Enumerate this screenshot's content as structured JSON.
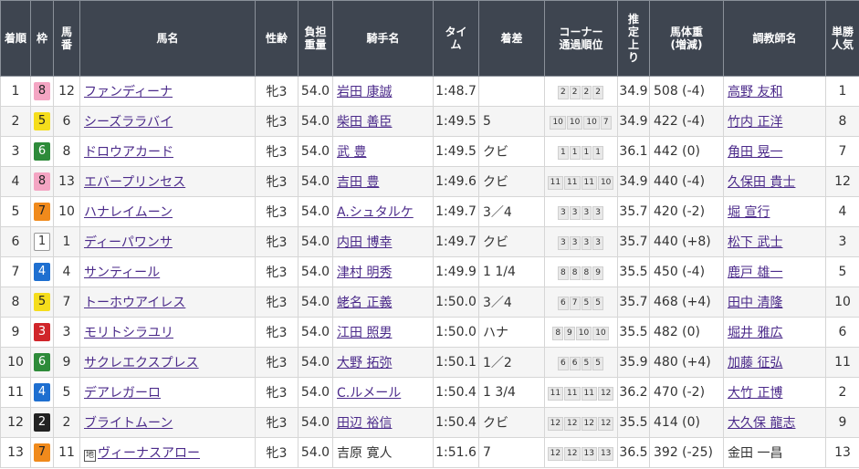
{
  "headers": {
    "rank": "着順",
    "waku": "枠",
    "umaban_1": "馬",
    "umaban_2": "番",
    "horse": "馬名",
    "sexage": "性齢",
    "weight_1": "負担",
    "weight_2": "重量",
    "jockey": "騎手名",
    "time_1": "タイ",
    "time_2": "ム",
    "margin": "着差",
    "corner_1": "コーナー",
    "corner_2": "通過順位",
    "last3f_1": "推",
    "last3f_2": "定",
    "last3f_3": "上",
    "last3f_4": "り",
    "bodyweight_1": "馬体重",
    "bodyweight_2": "(増減)",
    "trainer": "調教師名",
    "pop_1": "単勝",
    "pop_2": "人気"
  },
  "rows": [
    {
      "rank": "1",
      "waku": "8",
      "umaban": "12",
      "horse": "ファンディーナ",
      "sexage": "牝3",
      "weight": "54.0",
      "jockey": "岩田 康誠",
      "time": "1:48.7",
      "margin": "",
      "corners": [
        "2",
        "2",
        "2",
        "2"
      ],
      "last3f": "34.9",
      "bodyweight": "508 (-4)",
      "trainer": "高野 友和",
      "pop": "1"
    },
    {
      "rank": "2",
      "waku": "5",
      "umaban": "6",
      "horse": "シーズララバイ",
      "sexage": "牝3",
      "weight": "54.0",
      "jockey": "柴田 善臣",
      "time": "1:49.5",
      "margin": "5",
      "corners": [
        "10",
        "10",
        "10",
        "7"
      ],
      "last3f": "34.9",
      "bodyweight": "422 (-4)",
      "trainer": "竹内 正洋",
      "pop": "8"
    },
    {
      "rank": "3",
      "waku": "6",
      "umaban": "8",
      "horse": "ドロウアカード",
      "sexage": "牝3",
      "weight": "54.0",
      "jockey": "武 豊",
      "time": "1:49.5",
      "margin": "クビ",
      "corners": [
        "1",
        "1",
        "1",
        "1"
      ],
      "last3f": "36.1",
      "bodyweight": "442 (0)",
      "trainer": "角田 晃一",
      "pop": "7"
    },
    {
      "rank": "4",
      "waku": "8",
      "umaban": "13",
      "horse": "エバープリンセス",
      "sexage": "牝3",
      "weight": "54.0",
      "jockey": "吉田 豊",
      "time": "1:49.6",
      "margin": "クビ",
      "corners": [
        "11",
        "11",
        "11",
        "10"
      ],
      "last3f": "34.9",
      "bodyweight": "440 (-4)",
      "trainer": "久保田 貴士",
      "pop": "12"
    },
    {
      "rank": "5",
      "waku": "7",
      "umaban": "10",
      "horse": "ハナレイムーン",
      "sexage": "牝3",
      "weight": "54.0",
      "jockey": "A.シュタルケ",
      "time": "1:49.7",
      "margin": "3／4",
      "corners": [
        "3",
        "3",
        "3",
        "3"
      ],
      "last3f": "35.7",
      "bodyweight": "420 (-2)",
      "trainer": "堀 宣行",
      "pop": "4"
    },
    {
      "rank": "6",
      "waku": "1",
      "umaban": "1",
      "horse": "ディーパワンサ",
      "sexage": "牝3",
      "weight": "54.0",
      "jockey": "内田 博幸",
      "time": "1:49.7",
      "margin": "クビ",
      "corners": [
        "3",
        "3",
        "3",
        "3"
      ],
      "last3f": "35.7",
      "bodyweight": "440 (+8)",
      "trainer": "松下 武士",
      "pop": "3"
    },
    {
      "rank": "7",
      "waku": "4",
      "umaban": "4",
      "horse": "サンティール",
      "sexage": "牝3",
      "weight": "54.0",
      "jockey": "津村 明秀",
      "time": "1:49.9",
      "margin": "1 1/4",
      "corners": [
        "8",
        "8",
        "8",
        "9"
      ],
      "last3f": "35.5",
      "bodyweight": "450 (-4)",
      "trainer": "鹿戸 雄一",
      "pop": "5"
    },
    {
      "rank": "8",
      "waku": "5",
      "umaban": "7",
      "horse": "トーホウアイレス",
      "sexage": "牝3",
      "weight": "54.0",
      "jockey": "蛯名 正義",
      "time": "1:50.0",
      "margin": "3／4",
      "corners": [
        "6",
        "7",
        "5",
        "5"
      ],
      "last3f": "35.7",
      "bodyweight": "468 (+4)",
      "trainer": "田中 清隆",
      "pop": "10"
    },
    {
      "rank": "9",
      "waku": "3",
      "umaban": "3",
      "horse": "モリトシラユリ",
      "sexage": "牝3",
      "weight": "54.0",
      "jockey": "江田 照男",
      "time": "1:50.0",
      "margin": "ハナ",
      "corners": [
        "8",
        "9",
        "10",
        "10"
      ],
      "last3f": "35.5",
      "bodyweight": "482 (0)",
      "trainer": "堀井 雅広",
      "pop": "6"
    },
    {
      "rank": "10",
      "waku": "6",
      "umaban": "9",
      "horse": "サクレエクスプレス",
      "sexage": "牝3",
      "weight": "54.0",
      "jockey": "大野 拓弥",
      "time": "1:50.1",
      "margin": "1／2",
      "corners": [
        "6",
        "6",
        "5",
        "5"
      ],
      "last3f": "35.9",
      "bodyweight": "480 (+4)",
      "trainer": "加藤 征弘",
      "pop": "11"
    },
    {
      "rank": "11",
      "waku": "4",
      "umaban": "5",
      "horse": "デアレガーロ",
      "sexage": "牝3",
      "weight": "54.0",
      "jockey": "C.ルメール",
      "time": "1:50.4",
      "margin": "1 3/4",
      "corners": [
        "11",
        "11",
        "11",
        "12"
      ],
      "last3f": "36.2",
      "bodyweight": "470 (-2)",
      "trainer": "大竹 正博",
      "pop": "2"
    },
    {
      "rank": "12",
      "waku": "2",
      "umaban": "2",
      "horse": "ブライトムーン",
      "sexage": "牝3",
      "weight": "54.0",
      "jockey": "田辺 裕信",
      "time": "1:50.4",
      "margin": "クビ",
      "corners": [
        "12",
        "12",
        "12",
        "12"
      ],
      "last3f": "35.5",
      "bodyweight": "414 (0)",
      "trainer": "大久保 龍志",
      "pop": "9"
    },
    {
      "rank": "13",
      "waku": "7",
      "umaban": "11",
      "horse": "ヴィーナスアロー",
      "sexage": "牝3",
      "weight": "54.0",
      "jockey": "吉原 寛人",
      "time": "1:51.6",
      "margin": "7",
      "corners": [
        "12",
        "12",
        "13",
        "13"
      ],
      "last3f": "36.5",
      "bodyweight": "392 (-25)",
      "trainer": "金田 一昌",
      "pop": "13",
      "horse_prefix": "地",
      "jockey_plain": true,
      "trainer_plain": true
    }
  ]
}
